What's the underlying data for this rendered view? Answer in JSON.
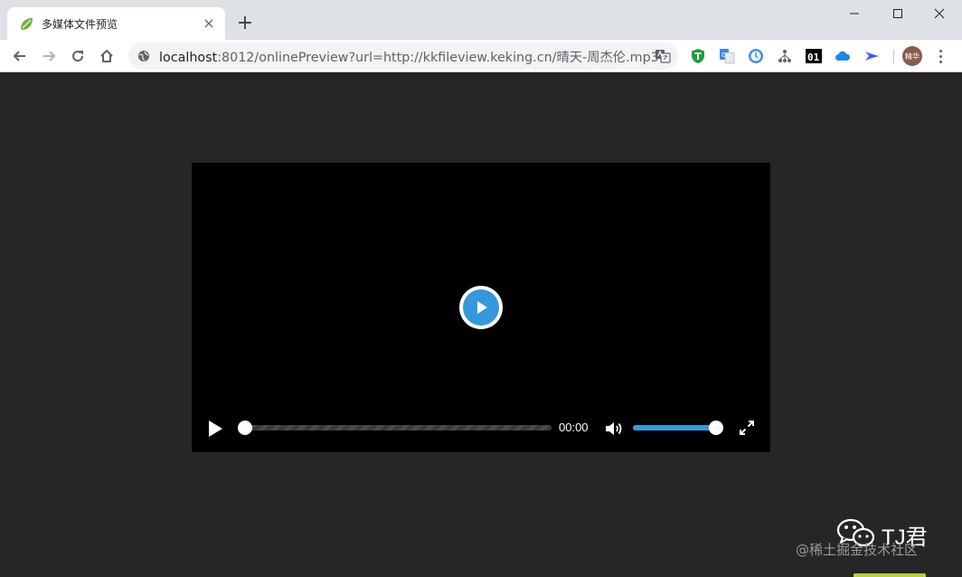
{
  "browser": {
    "tab": {
      "title": "多媒体文件预览",
      "favicon": "spring-leaf-icon"
    },
    "window_controls": [
      "minimize-icon",
      "maximize-icon",
      "close-icon"
    ],
    "address": {
      "host": "localhost",
      "rest": ":8012/onlinePreview?url=http://kkfileview.keking.cn/晴天-周杰伦.mp3"
    },
    "extensions": [
      "adguard-icon",
      "google-translate-icon",
      "clock-icon",
      "network-icon",
      "binary-icon",
      "cloud-icon",
      "bird-icon"
    ],
    "profile": {
      "label": "精华"
    }
  },
  "player": {
    "time": "00:00",
    "progress": 0,
    "volume": 1.0,
    "accent_color": "#3498db"
  },
  "watermark": {
    "name": "TJ君",
    "site": "@稀土掘金技术社区"
  }
}
